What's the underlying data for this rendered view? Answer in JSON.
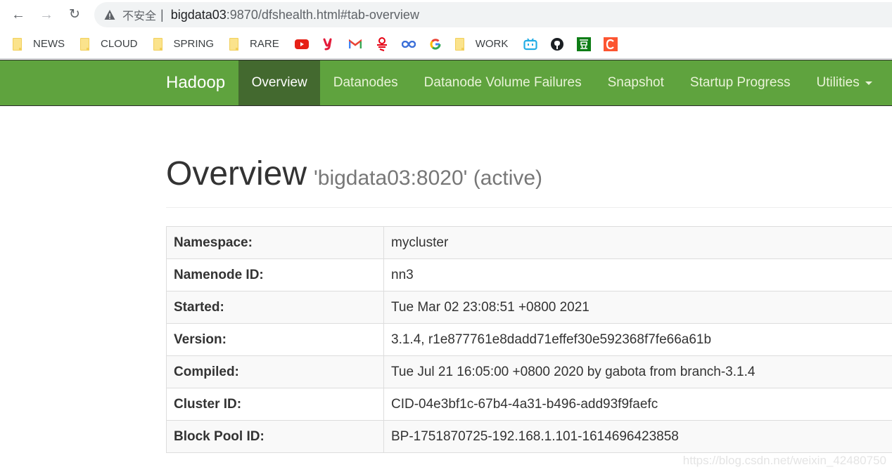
{
  "browser": {
    "back_label": "←",
    "forward_label": "→",
    "reload_label": "↻",
    "insecure_label": "不安全",
    "separator": "|",
    "url_host": "bigdata03",
    "url_rest": ":9870/dfshealth.html#tab-overview"
  },
  "bookmarks": [
    {
      "type": "folder",
      "label": "NEWS"
    },
    {
      "type": "folder",
      "label": "CLOUD"
    },
    {
      "type": "folder",
      "label": "SPRING"
    },
    {
      "type": "folder",
      "label": "RARE"
    },
    {
      "type": "icon",
      "icon": "youtube-icon"
    },
    {
      "type": "icon",
      "icon": "y-logo-icon"
    },
    {
      "type": "icon",
      "icon": "gmail-icon"
    },
    {
      "type": "icon",
      "icon": "netease-icon"
    },
    {
      "type": "icon",
      "icon": "infinity-icon"
    },
    {
      "type": "icon",
      "icon": "google-icon"
    },
    {
      "type": "folder",
      "label": "WORK"
    },
    {
      "type": "icon",
      "icon": "bilibili-icon"
    },
    {
      "type": "icon",
      "icon": "github-icon"
    },
    {
      "type": "icon",
      "icon": "douban-icon"
    },
    {
      "type": "icon",
      "icon": "csdn-icon"
    }
  ],
  "navbar": {
    "brand": "Hadoop",
    "items": [
      {
        "label": "Overview",
        "active": true
      },
      {
        "label": "Datanodes"
      },
      {
        "label": "Datanode Volume Failures"
      },
      {
        "label": "Snapshot"
      },
      {
        "label": "Startup Progress"
      },
      {
        "label": "Utilities",
        "dropdown": true
      }
    ]
  },
  "header": {
    "title": "Overview",
    "subtitle": "'bigdata03:8020' (active)"
  },
  "overview": [
    {
      "key": "Namespace:",
      "value": "mycluster"
    },
    {
      "key": "Namenode ID:",
      "value": "nn3"
    },
    {
      "key": "Started:",
      "value": "Tue Mar 02 23:08:51 +0800 2021"
    },
    {
      "key": "Version:",
      "value": "3.1.4, r1e877761e8dadd71effef30e592368f7fe66a61b"
    },
    {
      "key": "Compiled:",
      "value": "Tue Jul 21 16:05:00 +0800 2020 by gabota from branch-3.1.4"
    },
    {
      "key": "Cluster ID:",
      "value": "CID-04e3bf1c-67b4-4a31-b496-add93f9faefc"
    },
    {
      "key": "Block Pool ID:",
      "value": "BP-1751870725-192.168.1.101-1614696423858"
    }
  ],
  "watermark": "https://blog.csdn.net/weixin_42480750",
  "colors": {
    "navbar": "#5fa33e",
    "navbar_active": "#43692f"
  }
}
